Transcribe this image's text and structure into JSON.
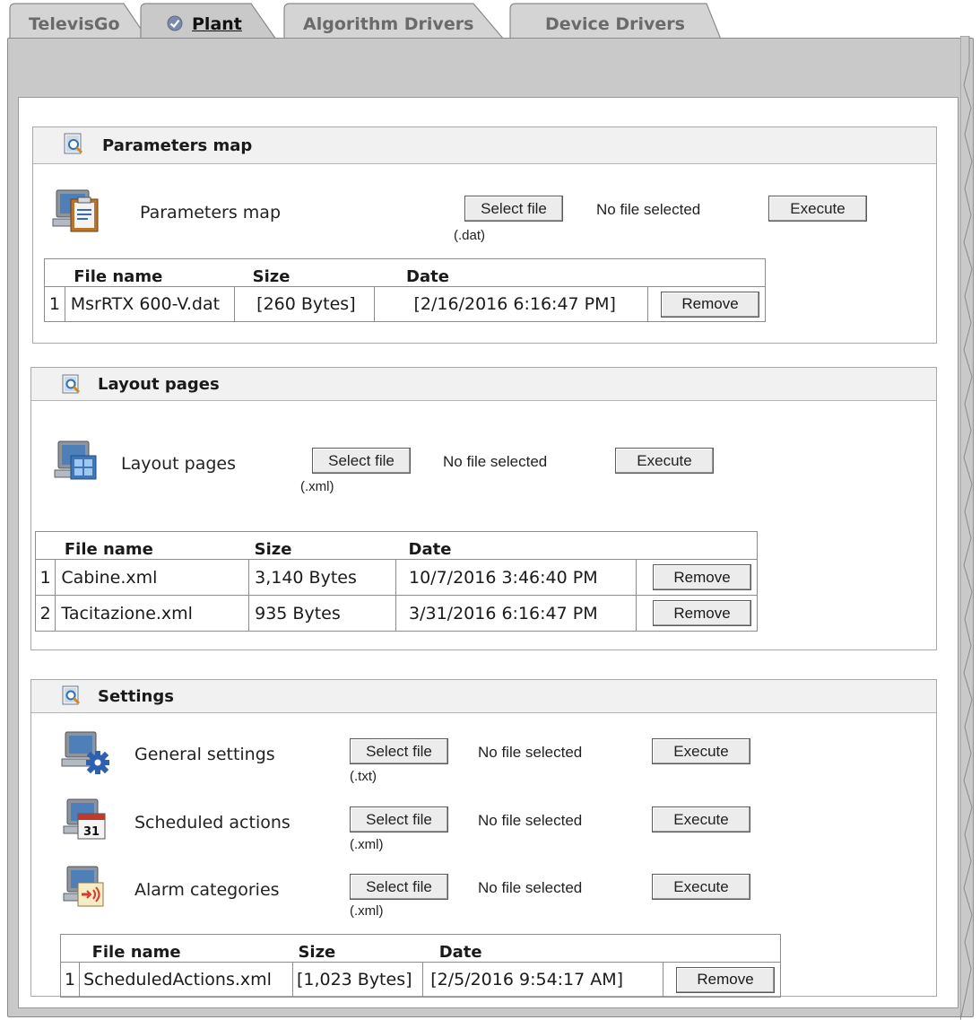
{
  "tabs": [
    {
      "label": "TelevisGo",
      "active": false
    },
    {
      "label": "Plant",
      "active": true
    },
    {
      "label": "Algorithm Drivers",
      "active": false
    },
    {
      "label": "Device Drivers",
      "active": false
    }
  ],
  "sections": {
    "parameters_map": {
      "title": "Parameters map",
      "row": {
        "label": "Parameters map",
        "select_label": "Select file",
        "hint": "(.dat)",
        "status": "No file selected",
        "execute_label": "Execute"
      },
      "table": {
        "headers": [
          "File name",
          "Size",
          "Date"
        ],
        "rows": [
          {
            "index": "1",
            "name": "MsrRTX 600-V.dat",
            "size": "[260 Bytes]",
            "date": "[2/16/2016 6:16:47 PM]",
            "remove_label": "Remove"
          }
        ]
      }
    },
    "layout_pages": {
      "title": "Layout pages",
      "row": {
        "label": "Layout pages",
        "select_label": "Select file",
        "hint": "(.xml)",
        "status": "No file selected",
        "execute_label": "Execute"
      },
      "table": {
        "headers": [
          "File name",
          "Size",
          "Date"
        ],
        "rows": [
          {
            "index": "1",
            "name": "Cabine.xml",
            "size": "3,140 Bytes",
            "date": "10/7/2016 3:46:40 PM",
            "remove_label": "Remove"
          },
          {
            "index": "2",
            "name": "Tacitazione.xml",
            "size": "935 Bytes",
            "date": "3/31/2016 6:16:47 PM",
            "remove_label": "Remove"
          }
        ]
      }
    },
    "settings": {
      "title": "Settings",
      "rows": [
        {
          "label": "General settings",
          "select_label": "Select file",
          "hint": "(.txt)",
          "status": "No file selected",
          "execute_label": "Execute"
        },
        {
          "label": "Scheduled actions",
          "select_label": "Select file",
          "hint": "(.xml)",
          "status": "No file selected",
          "execute_label": "Execute"
        },
        {
          "label": "Alarm categories",
          "select_label": "Select file",
          "hint": "(.xml)",
          "status": "No file selected",
          "execute_label": "Execute"
        }
      ],
      "calendar_day": "31",
      "table": {
        "headers": [
          "File name",
          "Size",
          "Date"
        ],
        "rows": [
          {
            "index": "1",
            "name": "ScheduledActions.xml",
            "size": "[1,023 Bytes]",
            "date": "[2/5/2016 9:54:17 AM]",
            "remove_label": "Remove"
          }
        ]
      }
    }
  },
  "colors": {
    "panel": "#c9c9c9",
    "tab_inactive": "#d4d4d4",
    "tab_inactive_text": "#6a6a6a",
    "check": "#7a8aa8"
  }
}
